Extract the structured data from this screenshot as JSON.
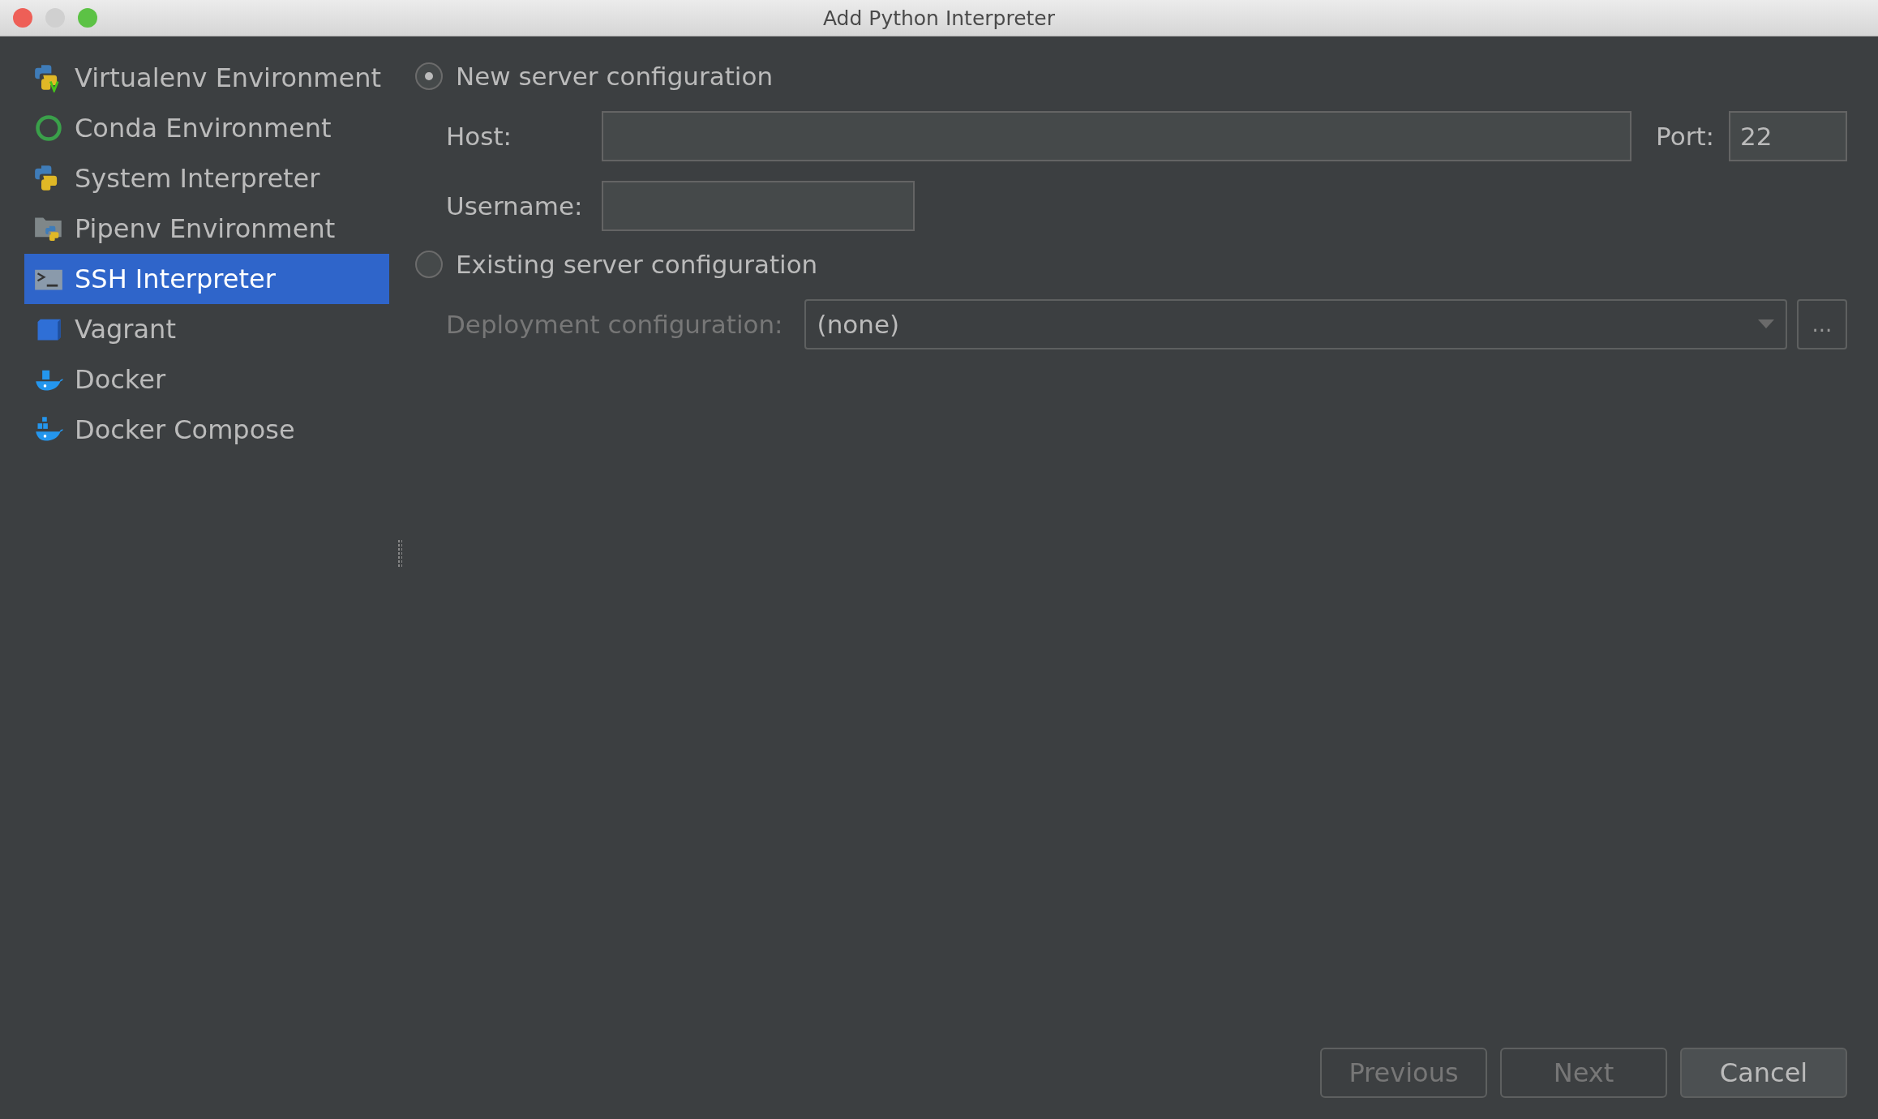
{
  "window": {
    "title": "Add Python Interpreter"
  },
  "sidebar": {
    "items": [
      {
        "label": "Virtualenv Environment",
        "kind": "virtualenv",
        "selected": false
      },
      {
        "label": "Conda Environment",
        "kind": "conda",
        "selected": false
      },
      {
        "label": "System Interpreter",
        "kind": "python",
        "selected": false
      },
      {
        "label": "Pipenv Environment",
        "kind": "pipenv",
        "selected": false
      },
      {
        "label": "SSH Interpreter",
        "kind": "terminal",
        "selected": true
      },
      {
        "label": "Vagrant",
        "kind": "vagrant",
        "selected": false
      },
      {
        "label": "Docker",
        "kind": "docker",
        "selected": false
      },
      {
        "label": "Docker Compose",
        "kind": "compose",
        "selected": false
      }
    ]
  },
  "new_server": {
    "label": "New server configuration",
    "selected": true,
    "host": {
      "label": "Host:"
    },
    "port": {
      "label": "Port:",
      "value": "22"
    },
    "username": {
      "label": "Username:"
    }
  },
  "existing_server": {
    "label": "Existing server configuration",
    "selected": false,
    "deployment": {
      "label": "Deployment configuration:",
      "value": "(none)",
      "disabled": true,
      "browse": "..."
    }
  },
  "buttons": [
    {
      "label": "Previous",
      "disabled": true
    },
    {
      "label": "Next",
      "disabled": true
    },
    {
      "label": "Cancel",
      "disabled": false
    }
  ]
}
